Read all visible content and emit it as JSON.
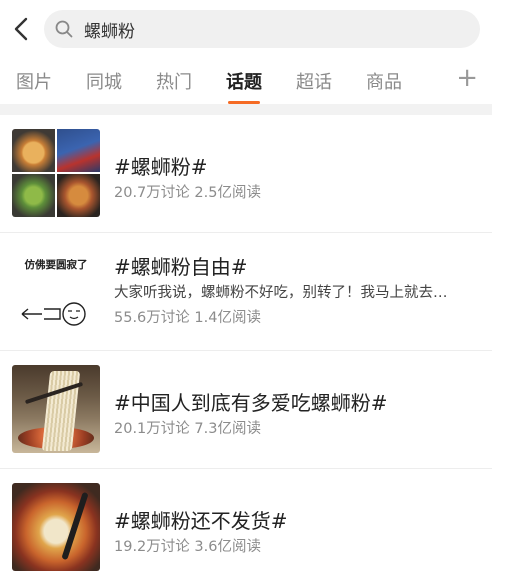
{
  "search": {
    "value": "螺蛳粉"
  },
  "tabs": [
    {
      "label": "图片",
      "active": false
    },
    {
      "label": "同城",
      "active": false
    },
    {
      "label": "热门",
      "active": false
    },
    {
      "label": "话题",
      "active": true
    },
    {
      "label": "超话",
      "active": false
    },
    {
      "label": "商品",
      "active": false
    }
  ],
  "tab_add_label": "+",
  "topics": [
    {
      "title": "#螺蛳粉#",
      "stats": "20.7万讨论 2.5亿阅读"
    },
    {
      "title": "#螺蛳粉自由#",
      "description": "大家听我说，螺蛳粉不好吃，别转了！我马上就去…",
      "stats": "55.6万讨论 1.4亿阅读",
      "thumb_caption": "仿佛要圆寂了"
    },
    {
      "title": "#中国人到底有多爱吃螺蛳粉#",
      "stats": "20.1万讨论 7.3亿阅读"
    },
    {
      "title": "#螺蛳粉还不发货#",
      "stats": "19.2万讨论 3.6亿阅读"
    }
  ],
  "colors": {
    "accent": "#f56b24",
    "divider": "#f2f2f2"
  },
  "icons": [
    "back-arrow-icon",
    "search-icon",
    "add-icon"
  ]
}
